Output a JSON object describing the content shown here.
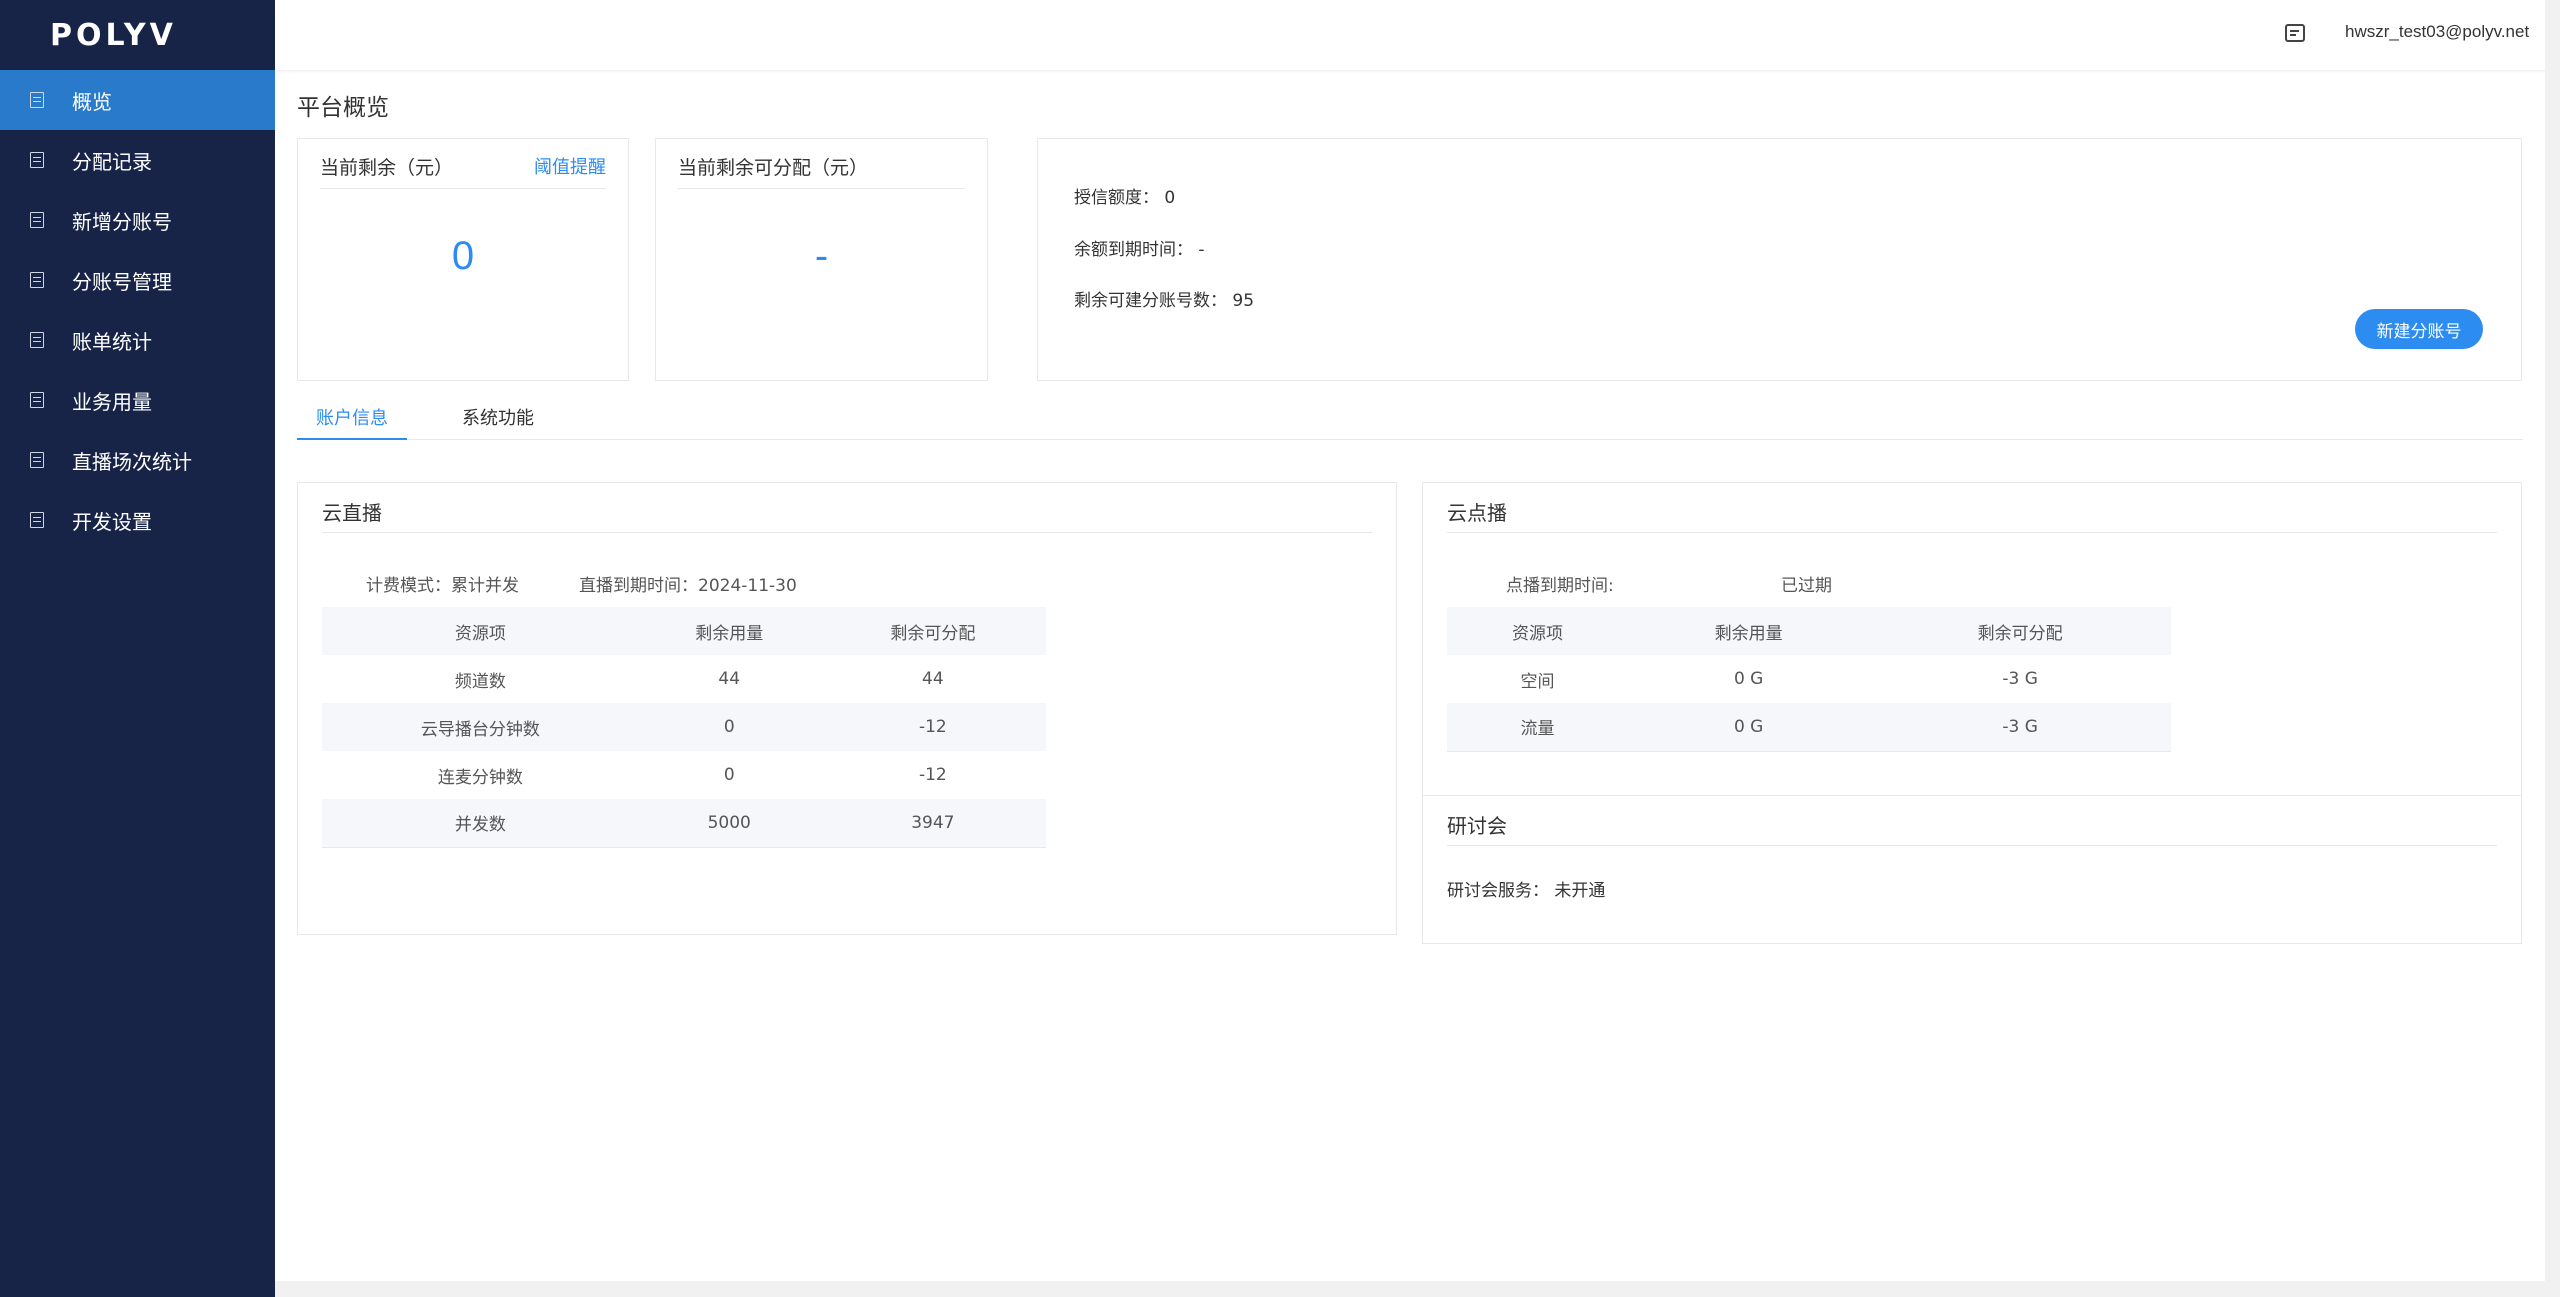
{
  "app": {
    "logo": "POLYV"
  },
  "sidebar": {
    "items": [
      {
        "label": "概览"
      },
      {
        "label": "分配记录"
      },
      {
        "label": "新增分账号"
      },
      {
        "label": "分账号管理"
      },
      {
        "label": "账单统计"
      },
      {
        "label": "业务用量"
      },
      {
        "label": "直播场次统计"
      },
      {
        "label": "开发设置"
      }
    ],
    "active_index": 0
  },
  "header": {
    "user_email": "hwszr_test03@polyv.net",
    "icon": "message-icon"
  },
  "page": {
    "title": "平台概览"
  },
  "balance_card": {
    "title": "当前剩余（元）",
    "link": "阈值提醒",
    "value": "0"
  },
  "allocatable_card": {
    "title": "当前剩余可分配（元）",
    "value": "-"
  },
  "credit_card": {
    "credit_line": "授信额度： 0",
    "expiry_line": "余额到期时间： -",
    "remaining_accounts_line": "剩余可建分账号数： 95",
    "new_button": "新建分账号"
  },
  "tabs": [
    {
      "label": "账户信息"
    },
    {
      "label": "系统功能"
    }
  ],
  "live": {
    "title": "云直播",
    "billing_mode": "计费模式：累计并发",
    "expiry": "直播到期时间：2024-11-30",
    "headers": [
      "资源项",
      "剩余用量",
      "剩余可分配"
    ],
    "rows": [
      [
        "频道数",
        "44",
        "44"
      ],
      [
        "云导播台分钟数",
        "0",
        "-12"
      ],
      [
        "连麦分钟数",
        "0",
        "-12"
      ],
      [
        "并发数",
        "5000",
        "3947"
      ]
    ]
  },
  "vod": {
    "title": "云点播",
    "expiry_label": "点播到期时间:",
    "expiry_value": "已过期",
    "headers": [
      "资源项",
      "剩余用量",
      "剩余可分配"
    ],
    "rows": [
      [
        "空间",
        "0 G",
        "-3 G"
      ],
      [
        "流量",
        "0 G",
        "-3 G"
      ]
    ]
  },
  "seminar": {
    "title": "研讨会",
    "service": "研讨会服务： 未开通"
  },
  "colors": {
    "sidebar_bg": "#172448",
    "active_item": "#2a7acb",
    "accent": "#2d8cf0"
  }
}
